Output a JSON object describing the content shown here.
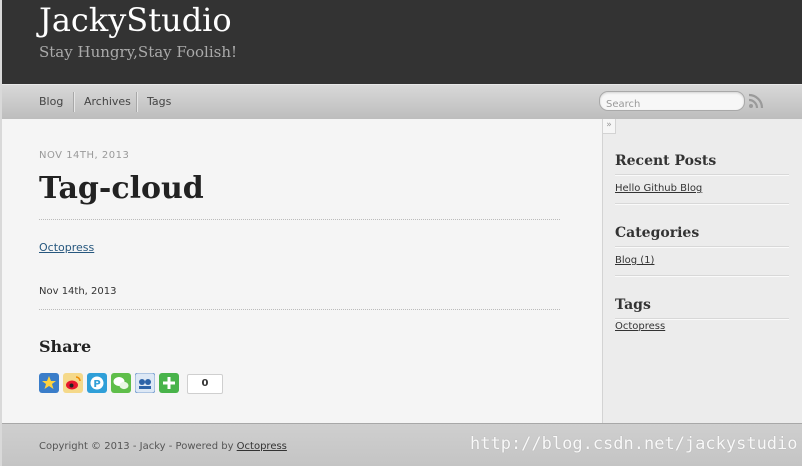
{
  "header": {
    "title": "JackyStudio",
    "subtitle": "Stay Hungry,Stay Foolish!"
  },
  "nav": {
    "items": [
      {
        "label": "Blog"
      },
      {
        "label": "Archives"
      },
      {
        "label": "Tags"
      }
    ],
    "search_placeholder": "Search",
    "rss_icon": "rss-icon"
  },
  "post": {
    "date": "NOV 14TH, 2013",
    "title": "Tag-cloud",
    "link": "Octopress",
    "footer_date": "Nov 14th, 2013"
  },
  "share": {
    "heading": "Share",
    "buttons": [
      "qzone-icon",
      "weibo-icon",
      "pengyou-icon",
      "wechat-icon",
      "renren-icon",
      "more-share-icon"
    ],
    "count": "0"
  },
  "sidebar": {
    "collapse_glyph": "»",
    "recent_posts": {
      "heading": "Recent Posts",
      "items": [
        "Hello Github Blog"
      ]
    },
    "categories": {
      "heading": "Categories",
      "items": [
        "Blog (1)"
      ]
    },
    "tags": {
      "heading": "Tags",
      "items": [
        "Octopress"
      ]
    }
  },
  "footer": {
    "copyright_prefix": "Copyright © 2013 - Jacky - Powered by ",
    "powered_link": "Octopress",
    "watermark": "http://blog.csdn.net/jackystudio"
  },
  "colors": {
    "header_bg": "#333333",
    "link": "#26577e"
  }
}
